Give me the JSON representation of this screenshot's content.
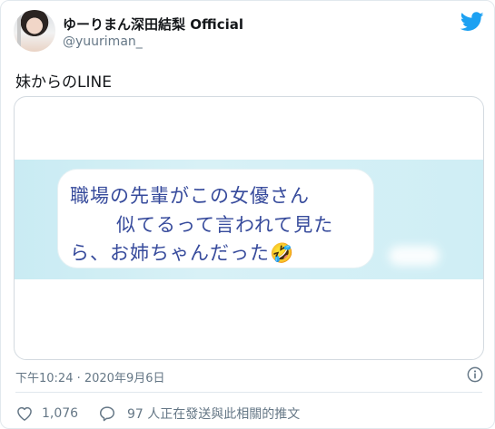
{
  "author": {
    "display_name": "ゆーりまん深田結梨 Official",
    "handle": "@yuuriman_"
  },
  "tweet": {
    "text": "妹からのLINE"
  },
  "media": {
    "line1": "職場の先輩がこの女優さん",
    "line2": "似てるって言われて見た",
    "line3": "ら、お姉ちゃんだった🤣"
  },
  "meta": {
    "timestamp": "下午10:24 · 2020年9月6日"
  },
  "actions": {
    "like_count": "1,076",
    "reply_text": "97 人正在發送與此相關的推文"
  },
  "colors": {
    "twitter_blue": "#1da1f2",
    "text_primary": "#14171a",
    "text_secondary": "#657786",
    "line_text": "#374b9c"
  },
  "icons": [
    "twitter-bird-icon",
    "info-icon",
    "heart-icon",
    "reply-icon"
  ]
}
